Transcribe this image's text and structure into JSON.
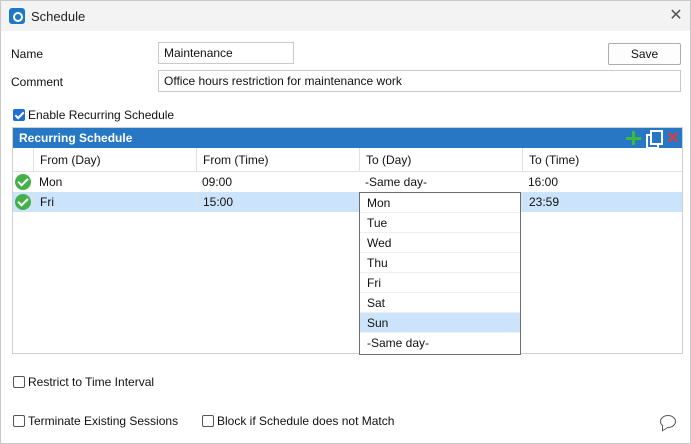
{
  "window": {
    "title": "Schedule",
    "close_glyph": "✕",
    "app_icon": "schedule-app-icon"
  },
  "form": {
    "name_label": "Name",
    "name_value": "Maintenance",
    "comment_label": "Comment",
    "comment_value": "Office hours restriction for maintenance work",
    "save_label": "Save"
  },
  "options": {
    "enable_recurring": {
      "label": "Enable Recurring Schedule",
      "checked": true
    },
    "restrict_time": {
      "label": "Restrict to Time Interval",
      "checked": false
    },
    "terminate_sessions": {
      "label": "Terminate Existing Sessions",
      "checked": false
    },
    "block_mismatch": {
      "label": "Block if Schedule does not Match",
      "checked": false
    }
  },
  "schedule_panel": {
    "title": "Recurring Schedule",
    "columns": [
      "From (Day)",
      "From (Time)",
      "To (Day)",
      "To (Time)"
    ],
    "rows": [
      {
        "from_day": "Mon",
        "from_time": "09:00",
        "to_day": "-Same day-",
        "to_time": "16:00",
        "status": "ok",
        "selected": false
      },
      {
        "from_day": "Fri",
        "from_time": "15:00",
        "to_day": "",
        "to_time": "23:59",
        "status": "ok",
        "selected": true
      }
    ],
    "accent": "#2777c4",
    "selection_color": "#cce4fb"
  },
  "to_day_dropdown": {
    "options": [
      "Mon",
      "Tue",
      "Wed",
      "Thu",
      "Fri",
      "Sat",
      "Sun",
      "-Same day-"
    ],
    "highlighted": "Sun"
  },
  "icons": {
    "add": "add-icon",
    "copy": "copy-icon",
    "delete": "delete-icon",
    "status_ok": "check-circle-icon",
    "feedback": "feedback-icon"
  }
}
